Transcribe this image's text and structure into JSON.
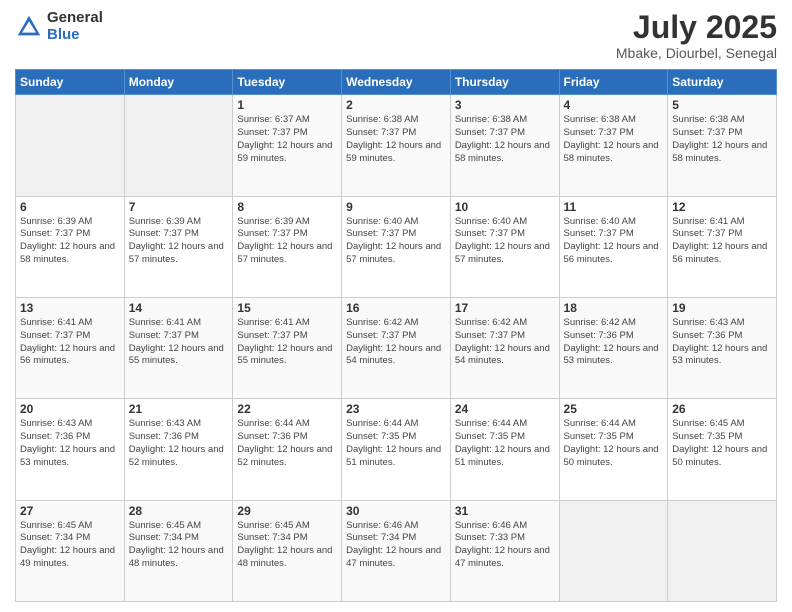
{
  "logo": {
    "general": "General",
    "blue": "Blue"
  },
  "title": {
    "month_year": "July 2025",
    "location": "Mbake, Diourbel, Senegal"
  },
  "weekdays": [
    "Sunday",
    "Monday",
    "Tuesday",
    "Wednesday",
    "Thursday",
    "Friday",
    "Saturday"
  ],
  "weeks": [
    [
      {
        "day": "",
        "info": ""
      },
      {
        "day": "",
        "info": ""
      },
      {
        "day": "1",
        "info": "Sunrise: 6:37 AM\nSunset: 7:37 PM\nDaylight: 12 hours and 59 minutes."
      },
      {
        "day": "2",
        "info": "Sunrise: 6:38 AM\nSunset: 7:37 PM\nDaylight: 12 hours and 59 minutes."
      },
      {
        "day": "3",
        "info": "Sunrise: 6:38 AM\nSunset: 7:37 PM\nDaylight: 12 hours and 58 minutes."
      },
      {
        "day": "4",
        "info": "Sunrise: 6:38 AM\nSunset: 7:37 PM\nDaylight: 12 hours and 58 minutes."
      },
      {
        "day": "5",
        "info": "Sunrise: 6:38 AM\nSunset: 7:37 PM\nDaylight: 12 hours and 58 minutes."
      }
    ],
    [
      {
        "day": "6",
        "info": "Sunrise: 6:39 AM\nSunset: 7:37 PM\nDaylight: 12 hours and 58 minutes."
      },
      {
        "day": "7",
        "info": "Sunrise: 6:39 AM\nSunset: 7:37 PM\nDaylight: 12 hours and 57 minutes."
      },
      {
        "day": "8",
        "info": "Sunrise: 6:39 AM\nSunset: 7:37 PM\nDaylight: 12 hours and 57 minutes."
      },
      {
        "day": "9",
        "info": "Sunrise: 6:40 AM\nSunset: 7:37 PM\nDaylight: 12 hours and 57 minutes."
      },
      {
        "day": "10",
        "info": "Sunrise: 6:40 AM\nSunset: 7:37 PM\nDaylight: 12 hours and 57 minutes."
      },
      {
        "day": "11",
        "info": "Sunrise: 6:40 AM\nSunset: 7:37 PM\nDaylight: 12 hours and 56 minutes."
      },
      {
        "day": "12",
        "info": "Sunrise: 6:41 AM\nSunset: 7:37 PM\nDaylight: 12 hours and 56 minutes."
      }
    ],
    [
      {
        "day": "13",
        "info": "Sunrise: 6:41 AM\nSunset: 7:37 PM\nDaylight: 12 hours and 56 minutes."
      },
      {
        "day": "14",
        "info": "Sunrise: 6:41 AM\nSunset: 7:37 PM\nDaylight: 12 hours and 55 minutes."
      },
      {
        "day": "15",
        "info": "Sunrise: 6:41 AM\nSunset: 7:37 PM\nDaylight: 12 hours and 55 minutes."
      },
      {
        "day": "16",
        "info": "Sunrise: 6:42 AM\nSunset: 7:37 PM\nDaylight: 12 hours and 54 minutes."
      },
      {
        "day": "17",
        "info": "Sunrise: 6:42 AM\nSunset: 7:37 PM\nDaylight: 12 hours and 54 minutes."
      },
      {
        "day": "18",
        "info": "Sunrise: 6:42 AM\nSunset: 7:36 PM\nDaylight: 12 hours and 53 minutes."
      },
      {
        "day": "19",
        "info": "Sunrise: 6:43 AM\nSunset: 7:36 PM\nDaylight: 12 hours and 53 minutes."
      }
    ],
    [
      {
        "day": "20",
        "info": "Sunrise: 6:43 AM\nSunset: 7:36 PM\nDaylight: 12 hours and 53 minutes."
      },
      {
        "day": "21",
        "info": "Sunrise: 6:43 AM\nSunset: 7:36 PM\nDaylight: 12 hours and 52 minutes."
      },
      {
        "day": "22",
        "info": "Sunrise: 6:44 AM\nSunset: 7:36 PM\nDaylight: 12 hours and 52 minutes."
      },
      {
        "day": "23",
        "info": "Sunrise: 6:44 AM\nSunset: 7:35 PM\nDaylight: 12 hours and 51 minutes."
      },
      {
        "day": "24",
        "info": "Sunrise: 6:44 AM\nSunset: 7:35 PM\nDaylight: 12 hours and 51 minutes."
      },
      {
        "day": "25",
        "info": "Sunrise: 6:44 AM\nSunset: 7:35 PM\nDaylight: 12 hours and 50 minutes."
      },
      {
        "day": "26",
        "info": "Sunrise: 6:45 AM\nSunset: 7:35 PM\nDaylight: 12 hours and 50 minutes."
      }
    ],
    [
      {
        "day": "27",
        "info": "Sunrise: 6:45 AM\nSunset: 7:34 PM\nDaylight: 12 hours and 49 minutes."
      },
      {
        "day": "28",
        "info": "Sunrise: 6:45 AM\nSunset: 7:34 PM\nDaylight: 12 hours and 48 minutes."
      },
      {
        "day": "29",
        "info": "Sunrise: 6:45 AM\nSunset: 7:34 PM\nDaylight: 12 hours and 48 minutes."
      },
      {
        "day": "30",
        "info": "Sunrise: 6:46 AM\nSunset: 7:34 PM\nDaylight: 12 hours and 47 minutes."
      },
      {
        "day": "31",
        "info": "Sunrise: 6:46 AM\nSunset: 7:33 PM\nDaylight: 12 hours and 47 minutes."
      },
      {
        "day": "",
        "info": ""
      },
      {
        "day": "",
        "info": ""
      }
    ]
  ]
}
